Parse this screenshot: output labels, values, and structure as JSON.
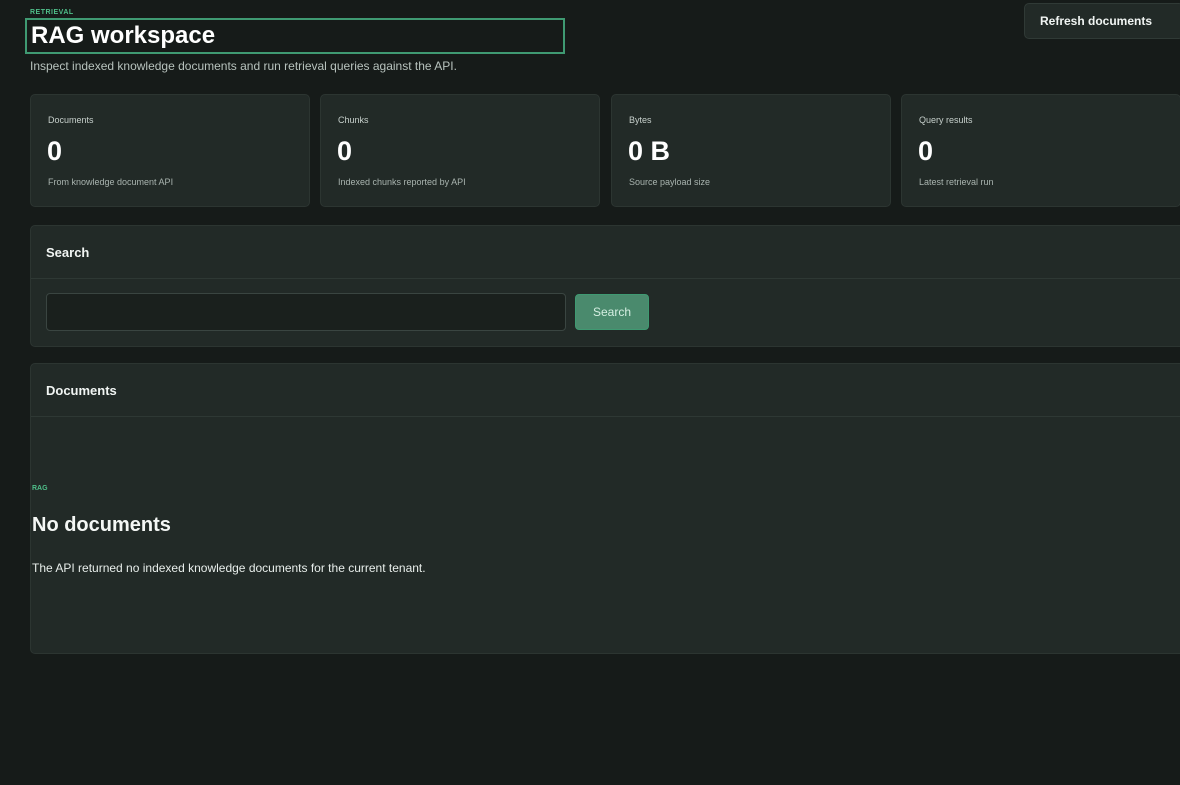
{
  "header": {
    "eyebrow": "RETRIEVAL",
    "title": "RAG workspace",
    "subtitle": "Inspect indexed knowledge documents and run retrieval queries against the API.",
    "refresh_label": "Refresh documents"
  },
  "stats": [
    {
      "label": "Documents",
      "value": "0",
      "note": "From knowledge document API"
    },
    {
      "label": "Chunks",
      "value": "0",
      "note": "Indexed chunks reported by API"
    },
    {
      "label": "Bytes",
      "value": "0 B",
      "note": "Source payload size"
    },
    {
      "label": "Query results",
      "value": "0",
      "note": "Latest retrieval run"
    }
  ],
  "search": {
    "title": "Search",
    "input_value": "",
    "placeholder": "",
    "button_label": "Search"
  },
  "documents": {
    "title": "Documents",
    "empty_eyebrow": "RAG",
    "empty_title": "No documents",
    "empty_text": "The API returned no indexed knowledge documents for the current tenant."
  },
  "colors": {
    "accent": "#4fbf8a",
    "background": "#161b19",
    "card": "#222a27",
    "button_primary": "#4a8a6d"
  }
}
